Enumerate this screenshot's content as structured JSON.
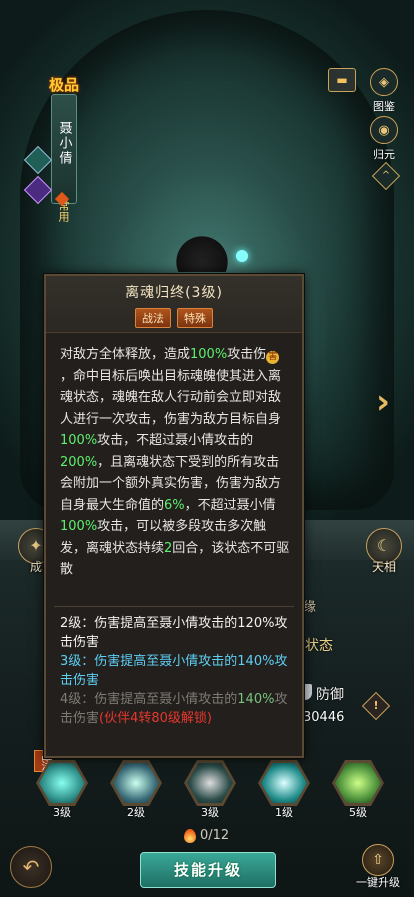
{
  "character": {
    "grade": "极品",
    "name": "聂小倩",
    "common_tag": "常用"
  },
  "right_menu": {
    "album": "图鉴",
    "return": "归元"
  },
  "side_buttons": {
    "left_label": "成",
    "right_label": "天相"
  },
  "background_text": {
    "t1": "缘",
    "t2": "状态",
    "t3": "防御",
    "t4": "30446"
  },
  "tooltip": {
    "title": "离魂归终(3级)",
    "tags": [
      "战法",
      "特殊"
    ],
    "desc": {
      "p1": "对敌方全体释放，造成",
      "v1": "100%",
      "p2": "攻击伤",
      "hurt_icon": "害",
      "p3": "，命中目标后唤出目标魂魄使其进入离魂状态，魂魄在敌人行动前会立即对敌人进行一次攻击，伤害为敌方目标自身",
      "v2": "100%",
      "p4": "攻击，不超过聂小倩攻击的",
      "v3": "200%",
      "p5": "，且离魂状态下受到的所有攻击会附加一个额外真实伤害，伤害为敌方自身最大生命值的",
      "v4": "6%",
      "p6": "，不超过聂小倩",
      "v5": "100%",
      "p7": "攻击，可以被多段攻击多次触发，离魂状态持续",
      "v6": "2",
      "p8": "回合，该状态不可驱散"
    },
    "levels": {
      "lv2": "2级：伤害提高至聂小倩攻击的120%攻击伤害",
      "lv3": "3级：伤害提高至聂小倩攻击的140%攻击伤害",
      "lv4_a": "4级：伤害提高至聂小倩攻击的",
      "lv4_pct": "140%",
      "lv4_b": "攻击伤害",
      "lv4_red": "(伙伴4转80级解锁)"
    }
  },
  "skills": [
    {
      "level": "3级",
      "color": "#2f8f8a",
      "tag": "战法"
    },
    {
      "level": "2级",
      "color": "#3b6d7a"
    },
    {
      "level": "3级",
      "color": "#2c4d4a"
    },
    {
      "level": "1级",
      "color": "#1f8c8a"
    },
    {
      "level": "5级",
      "color": "#4a8f3a"
    }
  ],
  "cost": "0/12",
  "upgrade_label": "技能升级",
  "oneclick_label": "一键升级",
  "colors": {
    "accent_gold": "#e9c57a",
    "highlight_green": "#5ef06e",
    "level3_blue": "#5ed0f5",
    "unlock_red": "#e6382e"
  }
}
